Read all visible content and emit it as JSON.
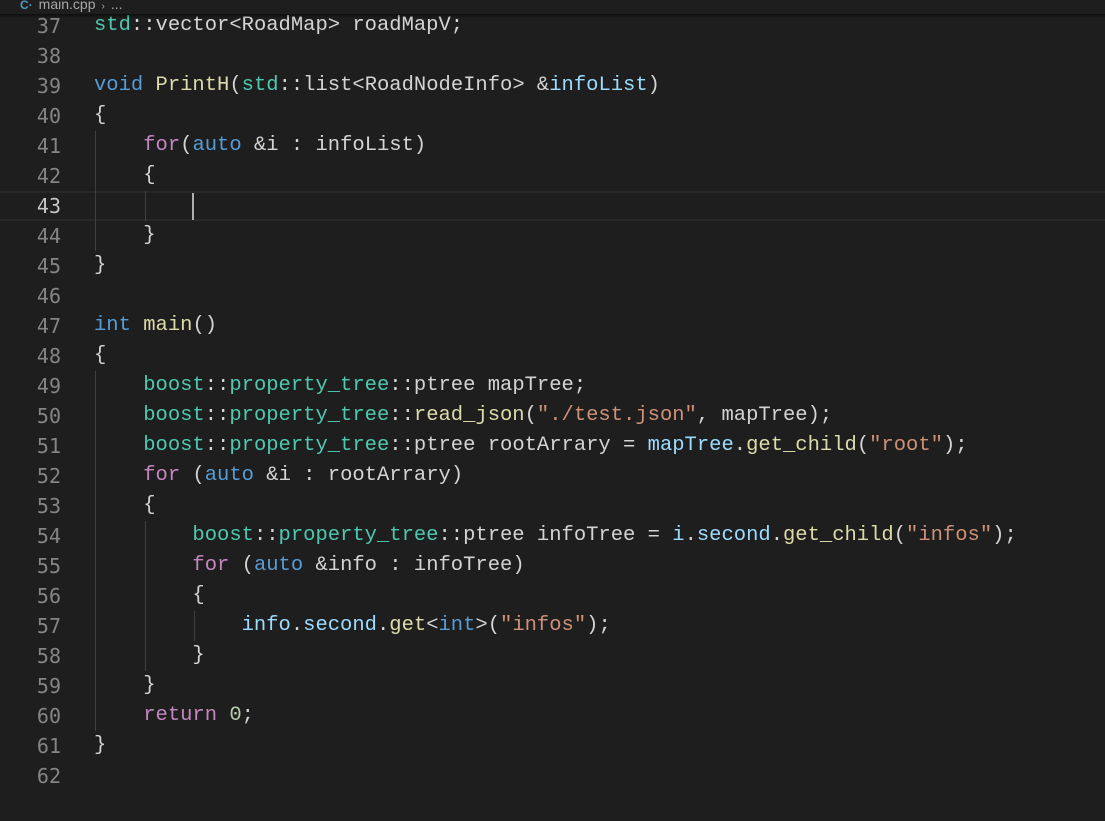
{
  "breadcrumb": {
    "file_name": "main.cpp",
    "separator": "›",
    "ellipsis": "..."
  },
  "editor": {
    "current_line": "43",
    "line_numbers": [
      "37",
      "38",
      "39",
      "40",
      "41",
      "42",
      "43",
      "44",
      "45",
      "46",
      "47",
      "48",
      "49",
      "50",
      "51",
      "52",
      "53",
      "54",
      "55",
      "56",
      "57",
      "58",
      "59",
      "60",
      "61",
      "62"
    ],
    "code_lines": [
      "std::vector<RoadMap> roadMapV;",
      "",
      "void PrintH(std::list<RoadNodeInfo> &infoList)",
      "{",
      "    for(auto &i : infoList)",
      "    {",
      "        ",
      "    }",
      "}",
      "",
      "int main()",
      "{",
      "    boost::property_tree::ptree mapTree;",
      "    boost::property_tree::read_json(\"./test.json\", mapTree);",
      "    boost::property_tree::ptree rootArrary = mapTree.get_child(\"root\");",
      "    for (auto &i : rootArrary)",
      "    {",
      "        boost::property_tree::ptree infoTree = i.second.get_child(\"infos\");",
      "        for (auto &info : infoTree)",
      "        {",
      "            info.second.get<int>(\"infos\");",
      "        }",
      "    }",
      "    return 0;",
      "}",
      ""
    ],
    "token_colors": {
      "keyword": "#569cd6",
      "control": "#c586c0",
      "type": "#4ec9b0",
      "function": "#dcdcaa",
      "variable": "#9cdcfe",
      "string": "#ce9178",
      "number": "#b5cea8",
      "default": "#d4d4d4",
      "background": "#1e1e1e"
    }
  }
}
